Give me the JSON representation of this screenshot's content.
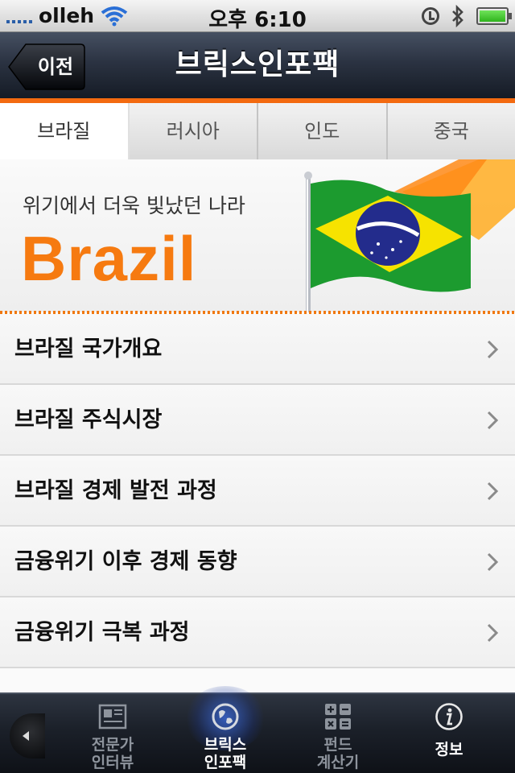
{
  "status_bar": {
    "carrier": "olleh",
    "time_prefix": "오후",
    "time": "6:10"
  },
  "nav": {
    "back_label": "이전",
    "title": "브릭스인포팩"
  },
  "tabs": [
    {
      "label": "브라질",
      "active": true
    },
    {
      "label": "러시아",
      "active": false
    },
    {
      "label": "인도",
      "active": false
    },
    {
      "label": "중국",
      "active": false
    }
  ],
  "banner": {
    "subtitle": "위기에서 더욱 빛났던 나라",
    "country": "Brazil"
  },
  "list": {
    "items": [
      {
        "label": "브라질 국가개요"
      },
      {
        "label": "브라질 주식시장"
      },
      {
        "label": "브라질 경제 발전 과정"
      },
      {
        "label": "금융위기 이후 경제 동향"
      },
      {
        "label": "금융위기 극복 과정"
      }
    ]
  },
  "tab_bar": {
    "items": [
      {
        "label_line1": "전문가",
        "label_line2": "인터뷰",
        "icon": "newspaper-icon"
      },
      {
        "label_line1": "브릭스",
        "label_line2": "인포팩",
        "icon": "globe-icon",
        "active": true
      },
      {
        "label_line1": "펀드",
        "label_line2": "계산기",
        "icon": "calculator-icon"
      },
      {
        "label_line1": "정보",
        "label_line2": "",
        "icon": "info-icon"
      }
    ]
  },
  "colors": {
    "accent": "#f36a10",
    "navbar_dark": "#1d2430",
    "tabbar_active_glow": "#3c6ee6"
  }
}
